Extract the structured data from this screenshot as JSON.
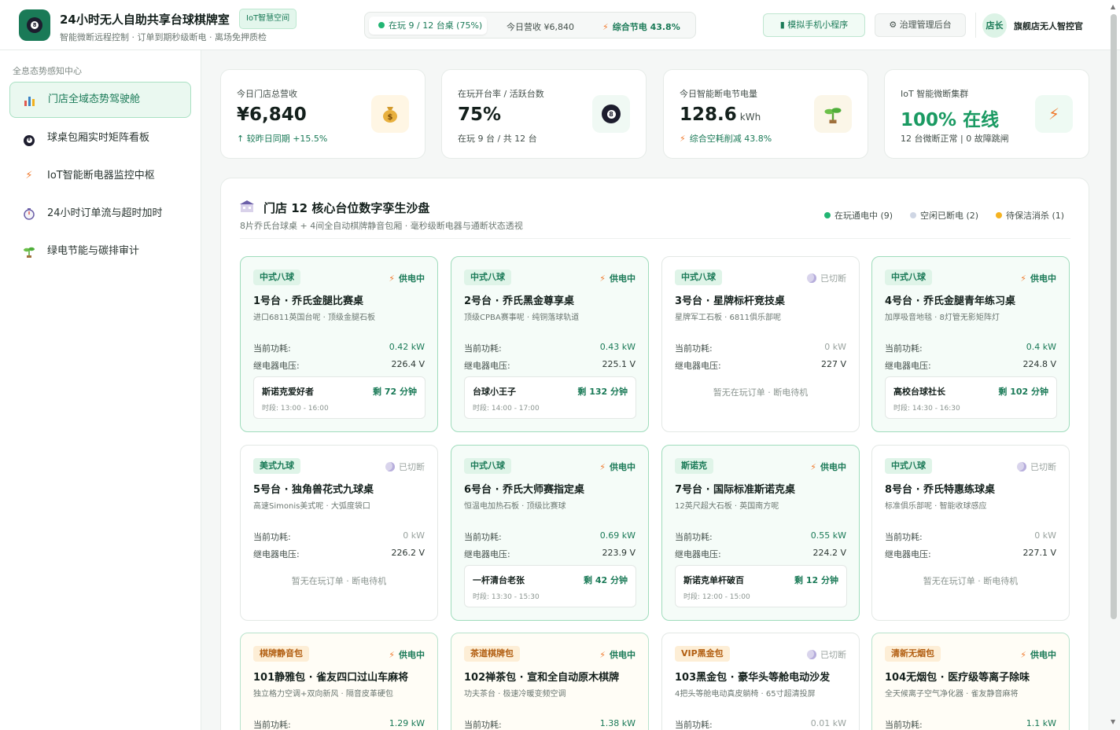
{
  "header": {
    "title": "24小时无人自助共享台球棋牌室",
    "badge": "IoT智慧空间",
    "subtitle": "智能微断远程控制 · 订单到期秒级断电 · 离场免押质检",
    "status_playing": "在玩 9 / 12 台桌 (75%)",
    "status_revenue": "今日营收 ¥6,840",
    "status_saving": "综合节电 43.8%",
    "btn_mini": "模拟手机小程序",
    "btn_admin": "治理管理后台",
    "avatar": "店长",
    "user_name": "旗舰店无人智控官"
  },
  "sidebar": {
    "title": "全息态势感知中心",
    "items": [
      {
        "label": "门店全域态势驾驶舱",
        "icon": "bar-chart-icon"
      },
      {
        "label": "球桌包厢实时矩阵看板",
        "icon": "billiard-ball-icon"
      },
      {
        "label": "IoT智能断电器监控中枢",
        "icon": "bolt-icon"
      },
      {
        "label": "24小时订单流与超时加时",
        "icon": "timer-icon"
      },
      {
        "label": "绿电节能与碳排审计",
        "icon": "sprout-icon"
      }
    ]
  },
  "stats": [
    {
      "label": "今日门店总营收",
      "value": "¥6,840",
      "unit": "",
      "note": "↑ 较昨日同期 +15.5%",
      "icon": "money-bag-icon"
    },
    {
      "label": "在玩开台率 / 活跃台数",
      "value": "75%",
      "unit": "",
      "note": "在玩 9 台 / 共 12 台",
      "icon": "billiard-ball-icon"
    },
    {
      "label": "今日智能断电节电量",
      "value": "128.6",
      "unit": "kWh",
      "note": "综合空耗削减 43.8%",
      "icon": "sprout-icon"
    },
    {
      "label": "IoT 智能微断集群",
      "value": "100% 在线",
      "unit": "",
      "note": "12 台微断正常 | 0 故障跳闸",
      "icon": "bolt-icon"
    }
  ],
  "twin": {
    "title": "门店 12 核心台位数字孪生沙盘",
    "subtitle": "8片乔氏台球桌 + 4间全自动棋牌静音包厢 · 毫秒级断电器与通断状态透视",
    "legend": [
      {
        "label": "在玩通电中 (9)",
        "color": "#22b573"
      },
      {
        "label": "空闲已断电 (2)",
        "color": "#cfd6e4"
      },
      {
        "label": "待保洁消杀 (1)",
        "color": "#f5b321"
      }
    ],
    "labels": {
      "power": "当前功耗:",
      "voltage": "继电器电压:",
      "on": "供电中",
      "off": "已切断",
      "idle": "暂无在玩订单 · 断电待机"
    },
    "tables": [
      {
        "tag": "中式八球",
        "status": "on",
        "name": "1号台 · 乔氏金腿比赛桌",
        "desc": "进口6811英国台呢 · 顶级金腿石板",
        "power": "0.42 kW",
        "voltage": "226.4 V",
        "user": "斯诺克爱好者",
        "left": "剩 72 分钟",
        "time": "时段: 13:00 - 16:00"
      },
      {
        "tag": "中式八球",
        "status": "on",
        "name": "2号台 · 乔氏黑金尊享桌",
        "desc": "顶级CPBA赛事呢 · 纯铜落球轨道",
        "power": "0.43 kW",
        "voltage": "225.1 V",
        "user": "台球小王子",
        "left": "剩 132 分钟",
        "time": "时段: 14:00 - 17:00"
      },
      {
        "tag": "中式八球",
        "status": "off",
        "name": "3号台 · 星牌标杆竞技桌",
        "desc": "星牌军工石板 · 6811俱乐部呢",
        "power": "0 kW",
        "voltage": "227 V"
      },
      {
        "tag": "中式八球",
        "status": "on",
        "name": "4号台 · 乔氏金腿青年练习桌",
        "desc": "加厚吸音地毯 · 8灯管无影矩阵灯",
        "power": "0.4 kW",
        "voltage": "224.8 V",
        "user": "高校台球社长",
        "left": "剩 102 分钟",
        "time": "时段: 14:30 - 16:30"
      },
      {
        "tag": "美式九球",
        "status": "off",
        "name": "5号台 · 独角兽花式九球桌",
        "desc": "高速Simonis美式呢 · 大弧度袋口",
        "power": "0 kW",
        "voltage": "226.2 V"
      },
      {
        "tag": "中式八球",
        "status": "on",
        "name": "6号台 · 乔氏大师赛指定桌",
        "desc": "恒温电加热石板 · 顶级比赛球",
        "power": "0.69 kW",
        "voltage": "223.9 V",
        "user": "一杆清台老张",
        "left": "剩 42 分钟",
        "time": "时段: 13:30 - 15:30"
      },
      {
        "tag": "斯诺克",
        "status": "on",
        "name": "7号台 · 国际标准斯诺克桌",
        "desc": "12英尺超大石板 · 英国南方呢",
        "power": "0.55 kW",
        "voltage": "224.2 V",
        "user": "斯诺克单杆破百",
        "left": "剩 12 分钟",
        "time": "时段: 12:00 - 15:00"
      },
      {
        "tag": "中式八球",
        "status": "off",
        "name": "8号台 · 乔氏特惠练球桌",
        "desc": "标准俱乐部呢 · 智能收球感应",
        "power": "0 kW",
        "voltage": "227.1 V"
      },
      {
        "tag": "棋牌静音包",
        "status": "on",
        "name": "101静雅包 · 雀友四口过山车麻将",
        "desc": "独立格力空调+双向新风 · 隔音皮革硬包",
        "power": "1.29 kW"
      },
      {
        "tag": "茶道棋牌包",
        "status": "on",
        "name": "102禅茶包 · 宣和全自动原木棋牌",
        "desc": "功夫茶台 · 极速冷暖变频空调",
        "power": "1.38 kW"
      },
      {
        "tag": "VIP黑金包",
        "status": "off",
        "name": "103黑金包 · 豪华头等舱电动沙发",
        "desc": "4把头等舱电动真皮躺椅 · 65寸超清投屏",
        "power": "0.01 kW"
      },
      {
        "tag": "清新无烟包",
        "status": "on",
        "name": "104无烟包 · 医疗级等离子除味",
        "desc": "全天候离子空气净化器 · 雀友静音麻将",
        "power": "1.1 kW"
      }
    ]
  }
}
